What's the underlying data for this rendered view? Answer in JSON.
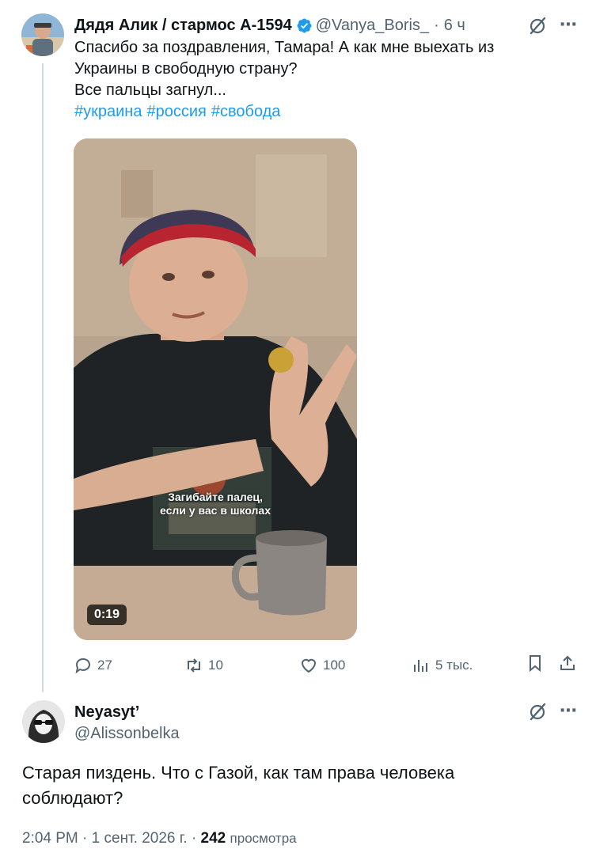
{
  "tweet": {
    "author_name": "Дядя Алик / стармос А-1594",
    "handle": "@Vanya_Boris_",
    "separator": "·",
    "time": "6 ч",
    "text_lines": [
      "Спасибо за поздравления, Тамара! А как мне выехать из",
      "Украины в свободную страну?",
      "Все пальцы загнул..."
    ],
    "hashtags": [
      "#украина",
      "#россия",
      "#свобода"
    ],
    "video": {
      "caption_line1": "Загибайте палец,",
      "caption_line2": "если у вас в школах",
      "duration": "0:19"
    },
    "actions": {
      "replies": "27",
      "reposts": "10",
      "likes": "100",
      "views": "5 тыс."
    },
    "more_icon": "⋯"
  },
  "reply": {
    "author_name": "Neyasyt’",
    "handle": "@Alissonbelka",
    "text_lines": [
      "Старая пиздень. Что с Газой, как там права человека",
      "соблюдают?"
    ],
    "time": "2:04 PM",
    "separator": "·",
    "date": "1 сент. 2026 г.",
    "separator2": "·",
    "views_count": "242",
    "views_label": "просмотра",
    "more_icon": "⋯"
  },
  "colors": {
    "accent": "#1d9bf0",
    "secondary_text": "#536471",
    "primary_text": "#0f1419",
    "thread_line": "#cfd9de"
  },
  "icons": [
    "verified-badge-icon",
    "grok-icon",
    "more-icon",
    "reply-icon",
    "repost-icon",
    "like-icon",
    "views-icon",
    "bookmark-icon",
    "share-icon"
  ]
}
